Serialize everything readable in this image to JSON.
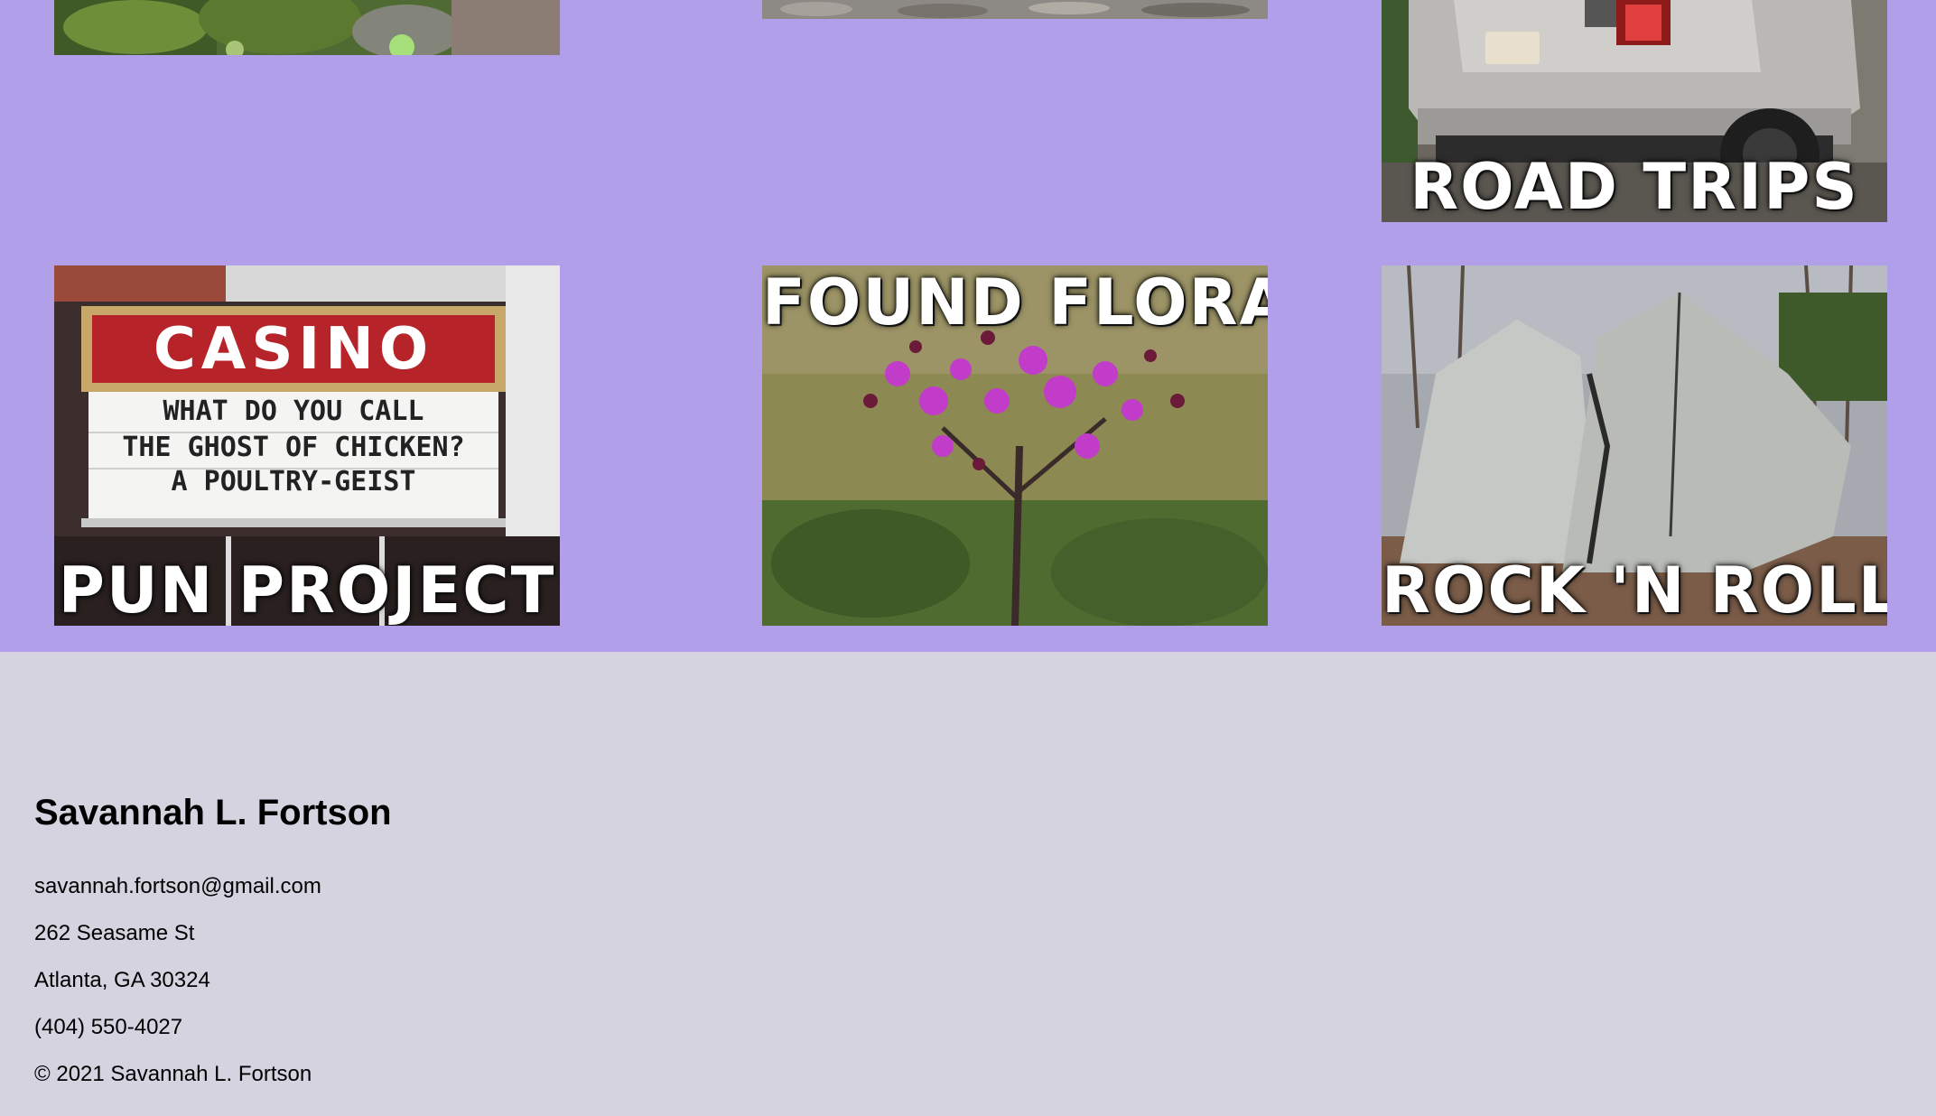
{
  "gallery": {
    "tiles": [
      {
        "id": "tile-nature-top",
        "caption": ""
      },
      {
        "id": "tile-gravel-top",
        "caption": ""
      },
      {
        "id": "tile-road-trips",
        "caption": "ROAD TRIPS"
      },
      {
        "id": "tile-pun-project",
        "caption": "PUN PROJECT",
        "sign_title": "CASINO",
        "sign_lines": [
          "WHAT DO YOU CALL",
          "THE GHOST OF CHICKEN?",
          "A POULTRY-GEIST"
        ]
      },
      {
        "id": "tile-found-flora",
        "caption": "FOUND FLORA"
      },
      {
        "id": "tile-rock-n-roll",
        "caption": "ROCK 'N ROLL"
      }
    ]
  },
  "footer": {
    "name": "Savannah L. Fortson",
    "email": "savannah.fortson@gmail.com",
    "street": "262 Seasame St",
    "city": "Atlanta, GA 30324",
    "phone": "(404) 550-4027",
    "copyright": "© 2021 Savannah L. Fortson"
  },
  "colors": {
    "gallery_bg": "#b1a0e9",
    "footer_bg": "#d5d3df"
  }
}
